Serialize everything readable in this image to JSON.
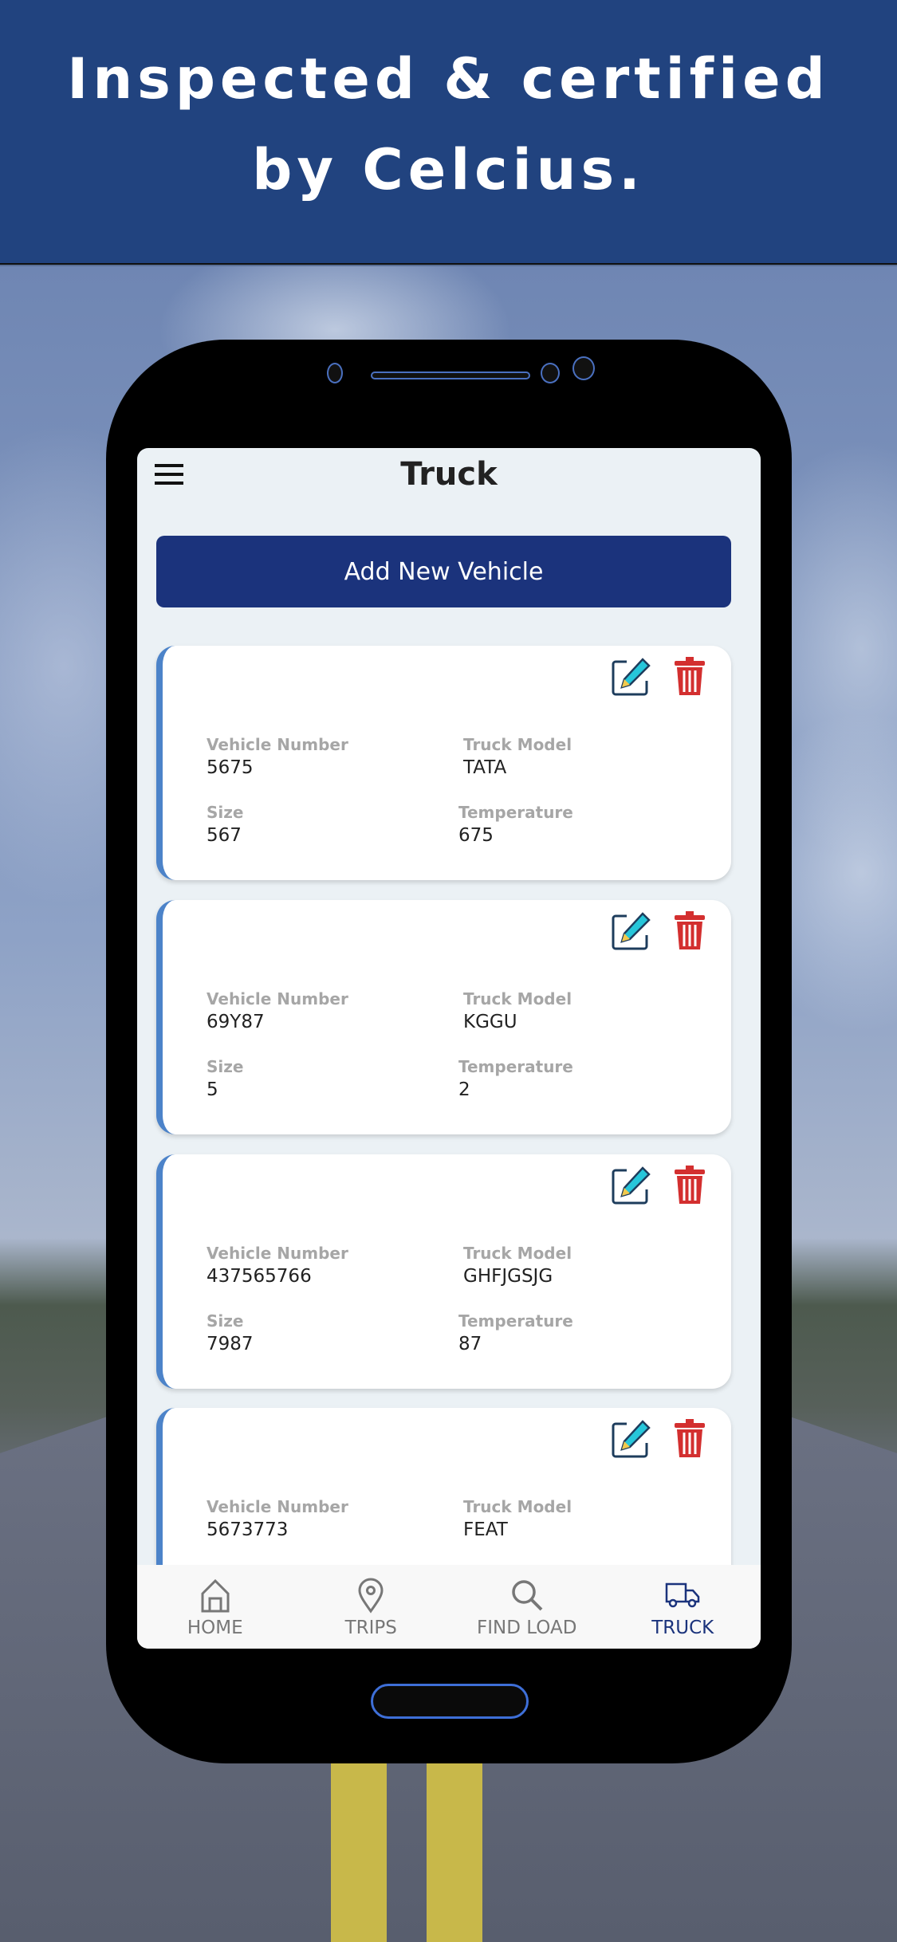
{
  "banner": {
    "line1": "Inspected & certified",
    "line2": "by Celcius."
  },
  "header": {
    "title": "Truck",
    "menu_icon": "hamburger-icon"
  },
  "add_button": "Add New Vehicle",
  "labels": {
    "vehicle_number": "Vehicle Number",
    "truck_model": "Truck Model",
    "size": "Size",
    "temperature": "Temperature"
  },
  "vehicles": [
    {
      "vehicle_number": "5675",
      "truck_model": "TATA",
      "size": "567",
      "temperature": "675"
    },
    {
      "vehicle_number": "69Y87",
      "truck_model": "KGGU",
      "size": "5",
      "temperature": "2"
    },
    {
      "vehicle_number": "437565766",
      "truck_model": "GHFJGSJG",
      "size": "7987",
      "temperature": "87"
    },
    {
      "vehicle_number": "5673773",
      "truck_model": "FEAT"
    }
  ],
  "nav": [
    {
      "label": "HOME",
      "icon": "home-icon"
    },
    {
      "label": "TRIPS",
      "icon": "map-pin-icon"
    },
    {
      "label": "FIND LOAD",
      "icon": "search-icon"
    },
    {
      "label": "TRUCK",
      "icon": "truck-icon",
      "active": true
    }
  ],
  "colors": {
    "banner": "#21437f",
    "primary": "#1b337c",
    "card_accent": "#4c83c9",
    "delete": "#d32f2f",
    "edit": "#26c6da"
  }
}
